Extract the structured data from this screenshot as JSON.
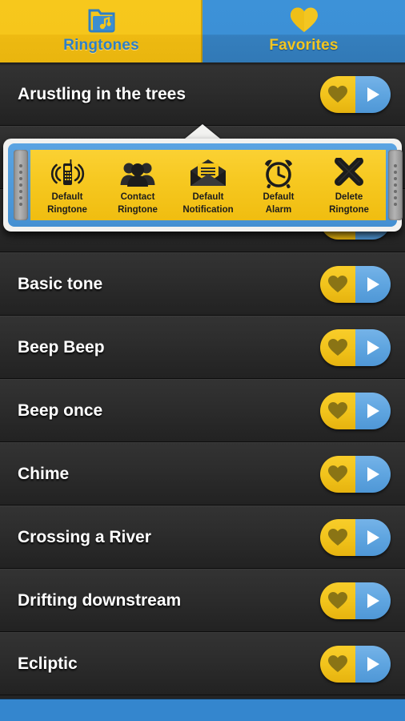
{
  "tabs": [
    {
      "label": "Ringtones",
      "icon": "music-folder-icon",
      "active": true
    },
    {
      "label": "Favorites",
      "icon": "heart-icon",
      "active": false
    }
  ],
  "colors": {
    "accent_yellow": "#F2C41C",
    "accent_blue": "#4F97D6",
    "bottom_bar_blue": "#3486CE",
    "row_background": "#2C2C2C",
    "row_text": "#FFFFFF",
    "heart_fill": "#8A7415",
    "tab_active_background": "#F6C61B",
    "tab_inactive_background": "#3C90D6"
  },
  "list": {
    "rows": [
      {
        "title": "Arustling in the trees",
        "favorite_icon": "heart-icon",
        "play_icon": "play-icon"
      },
      {
        "title": "",
        "favorite_icon": "heart-icon",
        "play_icon": "play-icon"
      },
      {
        "title": "",
        "favorite_icon": "heart-icon",
        "play_icon": "play-icon"
      },
      {
        "title": "Basic tone",
        "favorite_icon": "heart-icon",
        "play_icon": "play-icon"
      },
      {
        "title": "Beep Beep",
        "favorite_icon": "heart-icon",
        "play_icon": "play-icon"
      },
      {
        "title": "Beep once",
        "favorite_icon": "heart-icon",
        "play_icon": "play-icon"
      },
      {
        "title": "Chime",
        "favorite_icon": "heart-icon",
        "play_icon": "play-icon"
      },
      {
        "title": "Crossing a River",
        "favorite_icon": "heart-icon",
        "play_icon": "play-icon"
      },
      {
        "title": "Drifting downstream",
        "favorite_icon": "heart-icon",
        "play_icon": "play-icon"
      },
      {
        "title": "Ecliptic",
        "favorite_icon": "heart-icon",
        "play_icon": "play-icon"
      }
    ]
  },
  "popup": {
    "actions": [
      {
        "label_line1": "Default",
        "label_line2": "Ringtone",
        "icon": "ringing-phone-icon"
      },
      {
        "label_line1": "Contact",
        "label_line2": "Ringtone",
        "icon": "contacts-group-icon"
      },
      {
        "label_line1": "Default",
        "label_line2": "Notification",
        "icon": "open-envelope-icon"
      },
      {
        "label_line1": "Default",
        "label_line2": "Alarm",
        "icon": "alarm-clock-icon"
      },
      {
        "label_line1": "Delete",
        "label_line2": "Ringtone",
        "icon": "close-x-icon"
      }
    ]
  }
}
